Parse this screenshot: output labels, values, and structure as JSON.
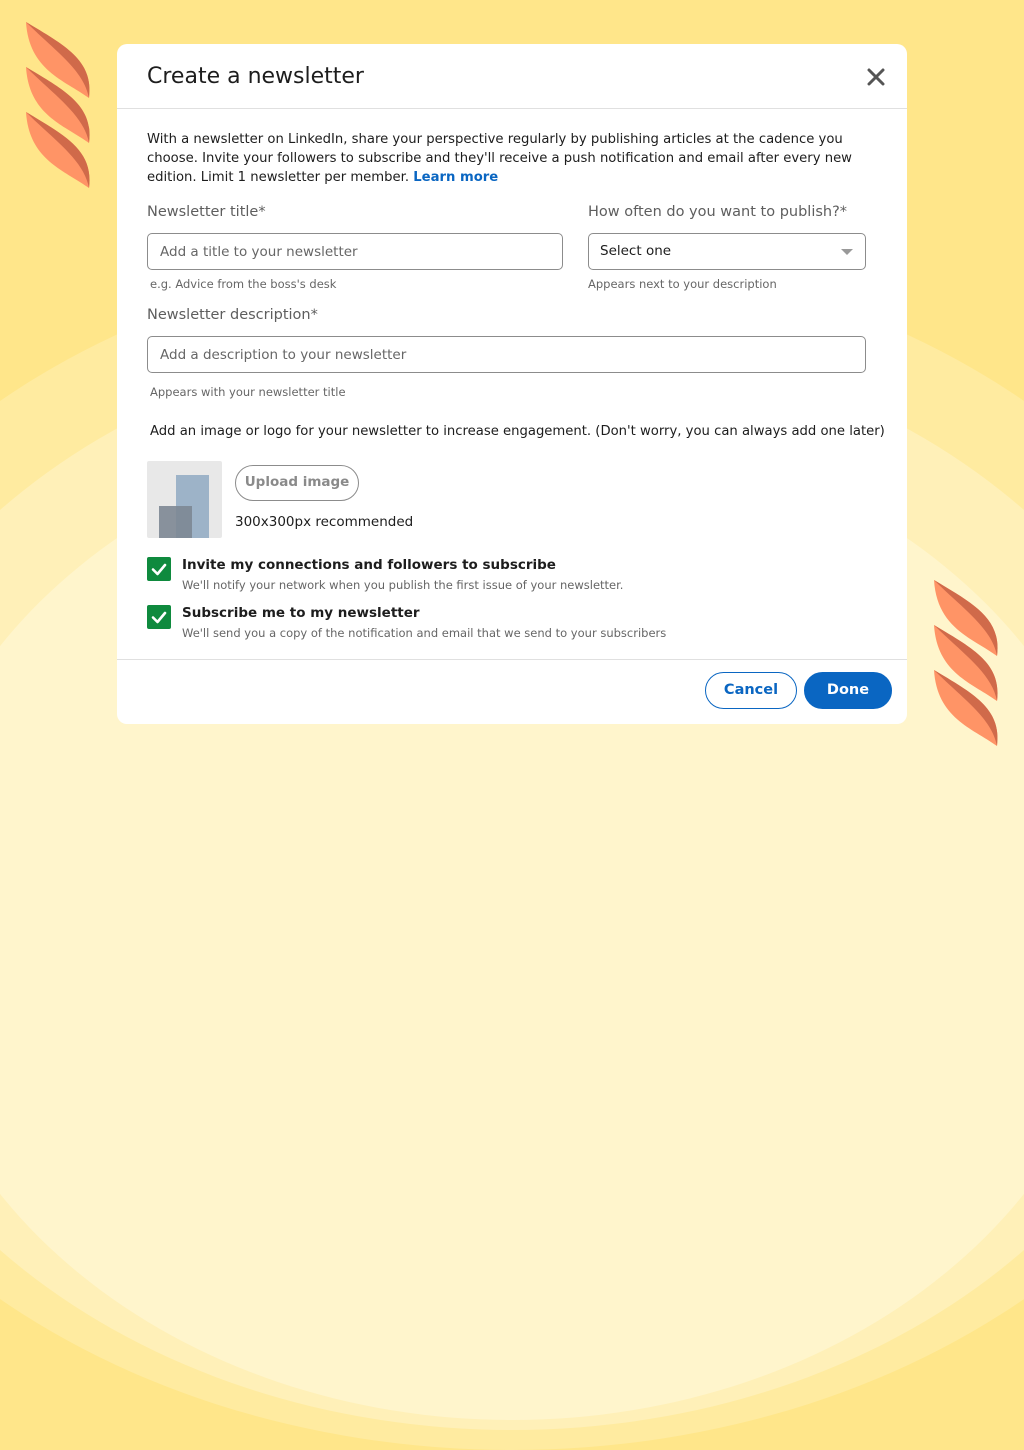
{
  "modal": {
    "title": "Create a newsletter",
    "close_icon": "close-icon",
    "intro_text": "With a newsletter on LinkedIn, share your perspective regularly by publishing articles at the cadence you choose. Invite your followers to subscribe and they'll receive a push notification and email after every new edition. Limit 1 newsletter per member.",
    "learn_more_label": "Learn more"
  },
  "form": {
    "title_field": {
      "label": "Newsletter title*",
      "placeholder": "Add a title to your newsletter",
      "value": "",
      "helper": "e.g. Advice from the boss's desk"
    },
    "frequency_field": {
      "label": "How often do you want to publish?*",
      "selected": "Select one",
      "helper": "Appears next to your description"
    },
    "description_field": {
      "label": "Newsletter description*",
      "placeholder": "Add a description to your newsletter",
      "value": "",
      "helper": "Appears with your newsletter title"
    },
    "image": {
      "note": "Add an image or logo for your newsletter to increase engagement.  (Don't worry, you can always add one later)",
      "upload_label": "Upload image",
      "recommendation": "300x300px recommended"
    },
    "checkboxes": [
      {
        "title": "Invite my connections and followers to subscribe",
        "subtitle": "We'll notify your network when you publish the first issue of your newsletter.",
        "checked": true
      },
      {
        "title": "Subscribe me to my newsletter",
        "subtitle": "We'll send you a copy of the notification and email that we send to your subscribers",
        "checked": true
      }
    ]
  },
  "footer": {
    "cancel_label": "Cancel",
    "done_label": "Done"
  },
  "colors": {
    "accent": "#0a66c2",
    "checkbox": "#0f8a3e",
    "background": "#ffe68a",
    "decor_orange": "#ff9466"
  }
}
